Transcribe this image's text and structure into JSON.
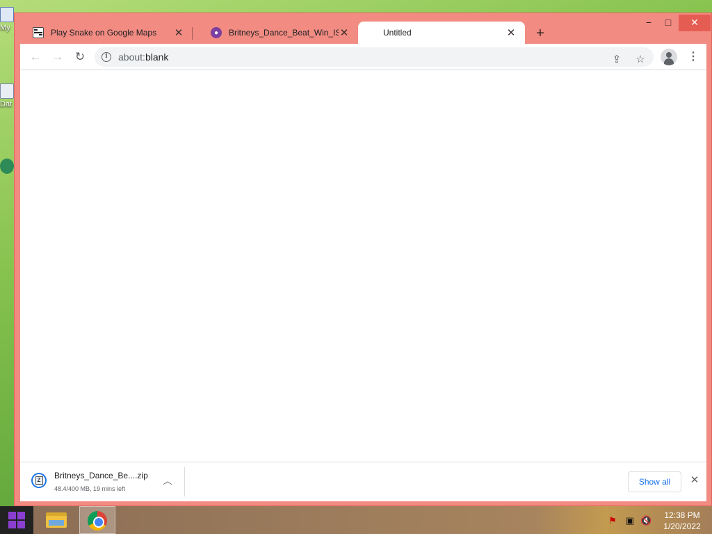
{
  "desktop": {
    "icons": [
      {
        "label": "My",
        "icon": "my-computer-icon"
      },
      {
        "label": "Dat",
        "icon": "database-icon"
      },
      {
        "label": "",
        "icon": "app-icon"
      }
    ]
  },
  "browser": {
    "tabs": [
      {
        "title": "Play Snake on Google Maps",
        "icon": "maps-snake-favicon",
        "active": false
      },
      {
        "title": "Britneys_Dance_Beat_Win_ISO_E",
        "icon": "iso-site-favicon",
        "active": false
      },
      {
        "title": "Untitled",
        "icon": "",
        "active": true
      }
    ],
    "new_tab_glyph": "+",
    "window_controls": {
      "minimize": "−",
      "maximize": "□",
      "close": "✕"
    },
    "address_bar": {
      "scheme": "about:",
      "host": "blank"
    },
    "page": {
      "background": "#ffffff"
    },
    "accent_color": "#f28b82"
  },
  "download_shelf": {
    "file_name": "Britneys_Dance_Be....zip",
    "status": "48.4/400 MB, 19 mins left",
    "progress_fraction": 0.121,
    "show_all_label": "Show all"
  },
  "taskbar": {
    "apps": [
      "file-explorer",
      "google-chrome"
    ],
    "tray_icons": [
      "action-center-flag-icon",
      "network-icon",
      "volume-muted-icon"
    ],
    "clock": {
      "time": "12:38 PM",
      "date": "1/20/2022"
    }
  }
}
